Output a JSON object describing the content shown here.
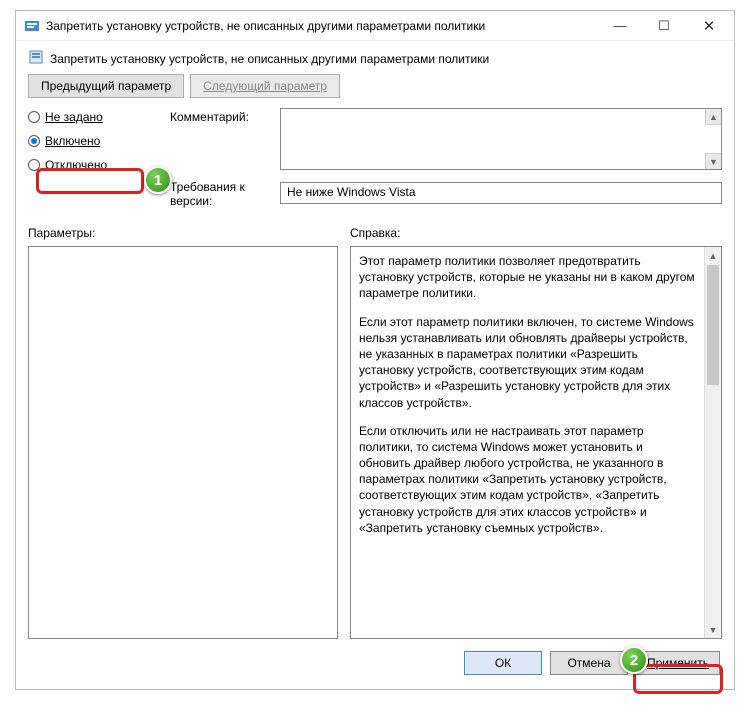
{
  "window": {
    "title": "Запретить установку устройств, не описанных другими параметрами политики",
    "minimize": "—",
    "maximize": "☐",
    "close": "✕"
  },
  "subtitle": "Запретить установку устройств, не описанных другими параметрами политики",
  "nav": {
    "prev": "Предыдущий параметр",
    "next": "Следующий параметр"
  },
  "state": {
    "not_configured": "Не задано",
    "enabled": "Включено",
    "disabled": "Отключено",
    "selected": "enabled"
  },
  "fields": {
    "comment_label": "Комментарий:",
    "requirements_label": "Требования к версии:",
    "requirements_value": "Не ниже Windows Vista"
  },
  "panels": {
    "options_label": "Параметры:",
    "help_label": "Справка:"
  },
  "help": {
    "p1": "Этот параметр политики позволяет предотвратить установку устройств, которые не указаны ни в каком другом параметре политики.",
    "p2": "Если этот параметр политики включен, то системе Windows нельзя устанавливать или обновлять драйверы устройств, не указанных в параметрах политики «Разрешить установку устройств, соответствующих этим кодам устройств» и «Разрешить установку устройств для этих классов устройств».",
    "p3": "Если отключить или не настраивать этот параметр политики, то система Windows может установить и обновить драйвер любого устройства, не указанного в параметрах политики «Запретить установку устройств, соответствующих этим кодам устройств», «Запретить установку устройств для этих классов устройств» и «Запретить установку съемных устройств»."
  },
  "footer": {
    "ok": "ОК",
    "cancel": "Отмена",
    "apply": "Применить"
  },
  "annotations": {
    "badge1": "1",
    "badge2": "2"
  }
}
